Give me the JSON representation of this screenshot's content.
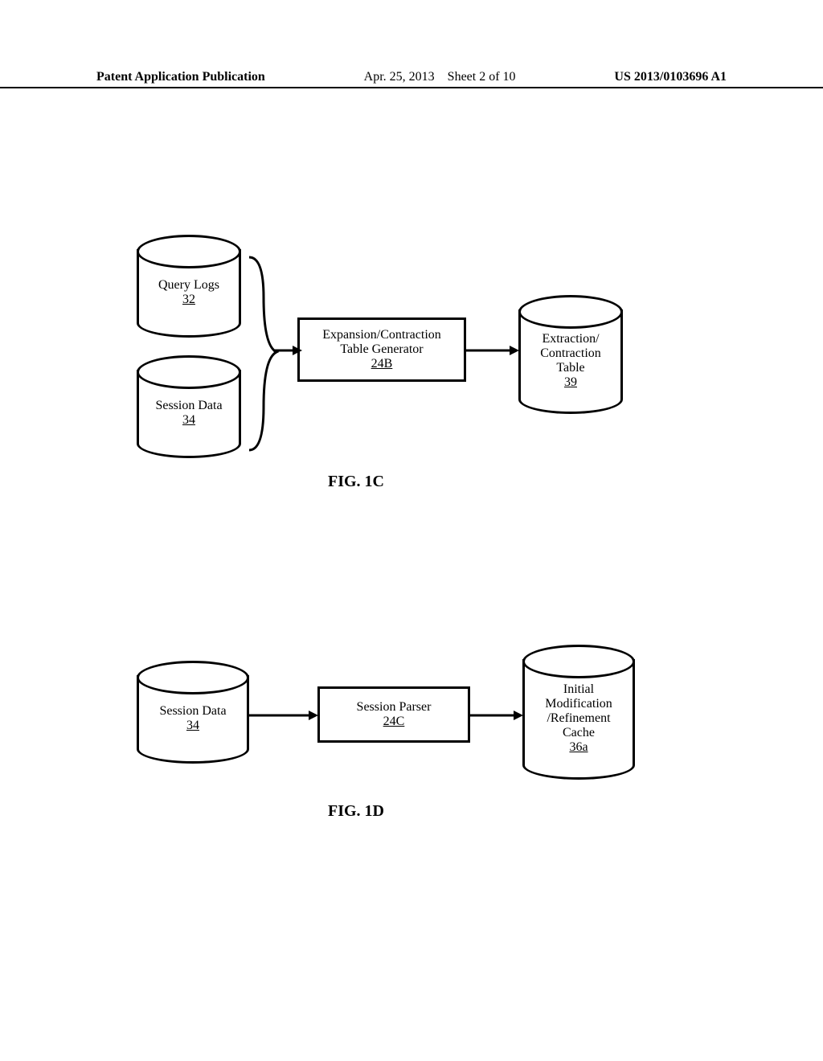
{
  "header": {
    "left": "Patent Application Publication",
    "date": "Apr. 25, 2013",
    "sheet": "Sheet 2 of 10",
    "pubno": "US 2013/0103696 A1"
  },
  "fig1c": {
    "caption": "FIG. 1C",
    "query_logs": {
      "label": "Query Logs",
      "ref": "32"
    },
    "session_data": {
      "label": "Session Data",
      "ref": "34"
    },
    "table_generator": {
      "line1": "Expansion/Contraction",
      "line2": "Table Generator",
      "ref": "24B"
    },
    "ext_table": {
      "line1": "Extraction/",
      "line2": "Contraction",
      "line3": "Table",
      "ref": "39"
    }
  },
  "fig1d": {
    "caption": "FIG. 1D",
    "session_data": {
      "label": "Session Data",
      "ref": "34"
    },
    "session_parser": {
      "label": "Session Parser",
      "ref": "24C"
    },
    "cache": {
      "line1": "Initial",
      "line2": "Modification",
      "line3": "/Refinement",
      "line4": "Cache",
      "ref": "36a"
    }
  }
}
